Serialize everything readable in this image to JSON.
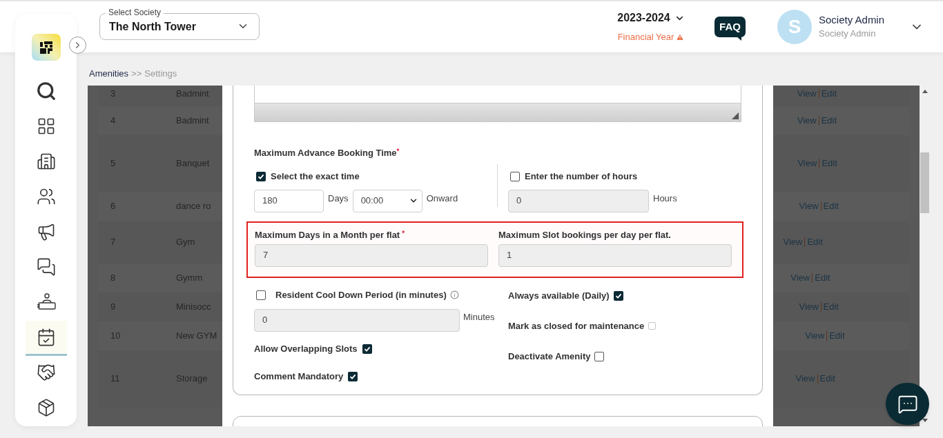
{
  "header": {
    "society_select": {
      "label": "Select Society",
      "value": "The North Tower"
    },
    "financial_year": {
      "value": "2023-2024",
      "label": "Financial Year"
    },
    "faq": "FAQ",
    "user": {
      "initial": "S",
      "name": "Society Admin",
      "role": "Society Admin"
    }
  },
  "sidebar": {
    "items": [
      {
        "selected": false
      },
      {
        "selected": false
      },
      {
        "selected": false
      },
      {
        "selected": false
      },
      {
        "selected": false
      },
      {
        "selected": false
      },
      {
        "selected": false
      },
      {
        "selected": true
      },
      {
        "selected": false
      },
      {
        "selected": false
      }
    ]
  },
  "breadcrumb": {
    "items": [
      "Amenities",
      "Settings"
    ],
    "separator": ">>"
  },
  "table": {
    "rows": [
      {
        "number": "3",
        "name": "Badmint",
        "actions": [
          "View",
          "Edit"
        ]
      },
      {
        "number": "4",
        "name": "Badmint",
        "actions": [
          "View",
          "Edit"
        ]
      },
      {
        "number": "5",
        "name": "Banquet",
        "actions": [
          "View",
          "Edit"
        ]
      },
      {
        "number": "6",
        "name": "dance ro",
        "actions": [
          "View",
          "Edit"
        ]
      },
      {
        "number": "7",
        "name": "Gym",
        "actions": [
          "View",
          "Edit"
        ]
      },
      {
        "number": "8",
        "name": "Gymm",
        "actions": [
          "View",
          "Edit"
        ]
      },
      {
        "number": "9",
        "name": "Minisocc",
        "actions": [
          "View",
          "Edit"
        ]
      },
      {
        "number": "10",
        "name": "New GYM",
        "actions": [
          "View",
          "Edit"
        ]
      },
      {
        "number": "11",
        "name": "Storage",
        "actions": [
          "View",
          "Edit"
        ]
      }
    ]
  },
  "modal": {
    "advance_booking": {
      "label": "Maximum Advance Booking Time",
      "required_mark": "*",
      "exact_time": {
        "label": "Select the exact time",
        "checked": true,
        "days": "180",
        "days_unit": "Days",
        "time": "00:00",
        "suffix": "Onward"
      },
      "hours": {
        "label": "Enter the number of hours",
        "checked": false,
        "value": "0",
        "unit": "Hours",
        "disabled": true
      }
    },
    "limits": {
      "highlighted": true,
      "fields": [
        {
          "label": "Maximum Days in a Month per flat",
          "required_mark": "*",
          "value": "7",
          "disabled": true
        },
        {
          "label": "Maximum Slot bookings per day per flat.",
          "value": "1",
          "disabled": true
        }
      ]
    },
    "cool_down": {
      "label": "Resident Cool Down Period (in minutes)",
      "checked": false,
      "value": "0",
      "unit": "Minutes",
      "disabled": true
    },
    "left_options": [
      {
        "label": "Allow Overlapping Slots",
        "checked": true
      },
      {
        "label": "Comment Mandatory",
        "checked": true
      }
    ],
    "right_options": [
      {
        "label": "Always available (Daily)",
        "checked": true
      },
      {
        "label": "Mark as closed for maintenance",
        "checked": false,
        "disabled": true
      },
      {
        "label": "Deactivate Amenity",
        "checked": false
      }
    ]
  }
}
